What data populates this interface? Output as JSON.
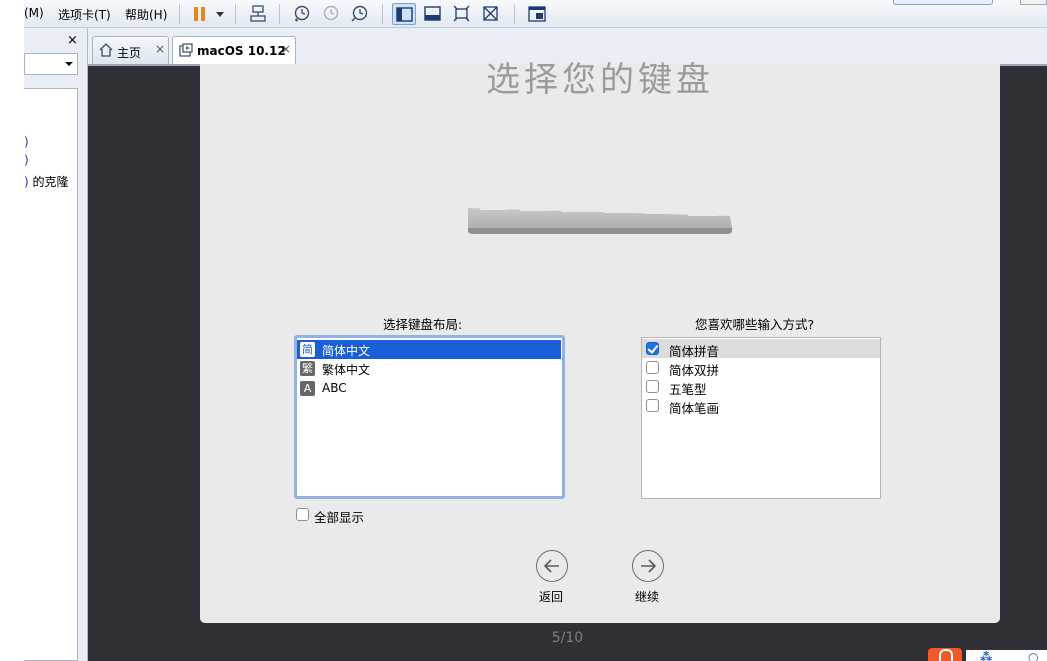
{
  "menubar": {
    "items": [
      {
        "label": "(M)",
        "x_hint": "view"
      },
      {
        "label": "选项卡(T)"
      },
      {
        "label": "帮助(H)"
      }
    ]
  },
  "library": {
    "close_glyph": "×",
    "tree_fragment": "的克隆"
  },
  "tabs": [
    {
      "label": "主页",
      "close_glyph": "×"
    },
    {
      "label": "macOS 10.12",
      "close_glyph": "×"
    }
  ],
  "installer": {
    "title": "选择您的键盘",
    "layout_label": "选择键盘布局:",
    "layouts": [
      {
        "icon": "简",
        "label": "简体中文",
        "selected": true
      },
      {
        "icon": "繁",
        "label": "繁体中文",
        "selected": false
      },
      {
        "icon": "A",
        "label": "ABC",
        "selected": false
      }
    ],
    "input_label": "您喜欢哪些输入方式?",
    "input_methods": [
      {
        "label": "简体拼音",
        "checked": true
      },
      {
        "label": "简体双拼",
        "checked": false
      },
      {
        "label": "五笔型",
        "checked": false
      },
      {
        "label": "简体笔画",
        "checked": false
      }
    ],
    "show_all_label": "全部显示",
    "back_label": "返回",
    "continue_label": "继续"
  },
  "page_indicator": "5/10",
  "colors": {
    "selection": "#1b5fd6",
    "checkbox_checked": "#1f73e8",
    "vm_background": "#303136",
    "installer_background": "#eaeaea"
  }
}
